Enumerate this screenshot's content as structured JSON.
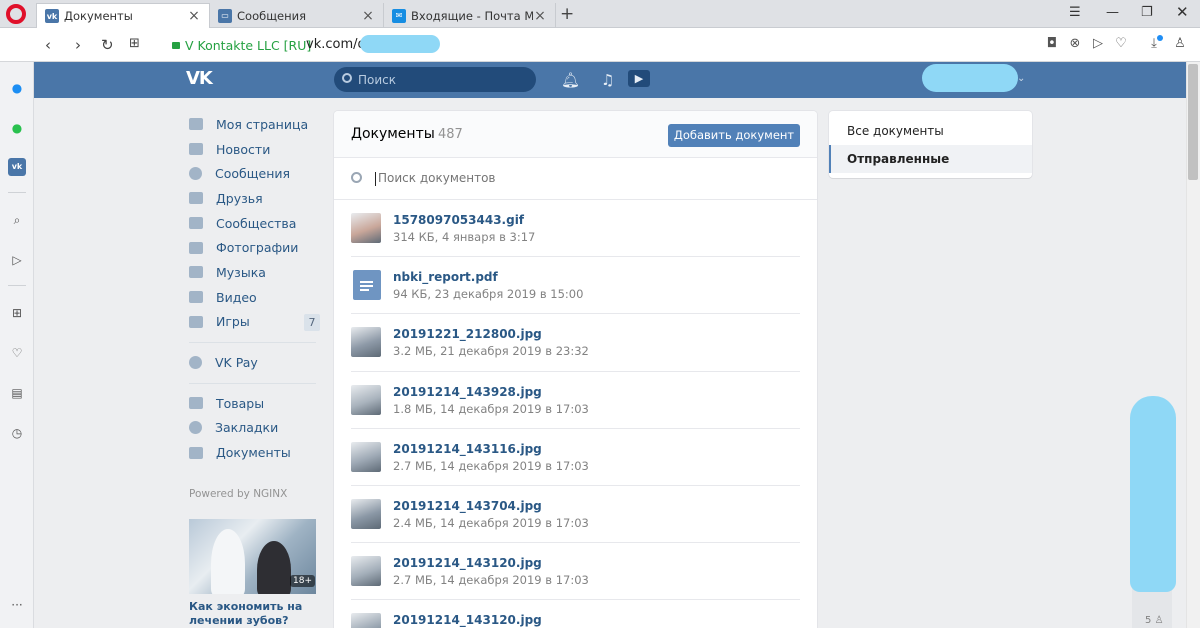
{
  "browser": {
    "tabs": [
      {
        "title": "Документы",
        "favicon": "vk-icon",
        "active": true
      },
      {
        "title": "Сообщения",
        "favicon": "vk-chat-icon",
        "active": false
      },
      {
        "title": "Входящие - Почта Mail.ru",
        "favicon": "mail-icon",
        "active": false
      }
    ],
    "secure_label": "V Kontakte LLC [RU]",
    "url": "vk.com/doc",
    "accent": "#e0102a"
  },
  "vk": {
    "search_placeholder": "Поиск",
    "brand_color": "#4a76a8"
  },
  "left_menu": {
    "items": [
      {
        "label": "Моя страница",
        "icon": "home-icon"
      },
      {
        "label": "Новости",
        "icon": "news-icon"
      },
      {
        "label": "Сообщения",
        "icon": "messages-icon"
      },
      {
        "label": "Друзья",
        "icon": "friends-icon"
      },
      {
        "label": "Сообщества",
        "icon": "groups-icon"
      },
      {
        "label": "Фотографии",
        "icon": "photo-icon"
      },
      {
        "label": "Музыка",
        "icon": "music-icon"
      },
      {
        "label": "Видео",
        "icon": "video-icon"
      },
      {
        "label": "Игры",
        "icon": "games-icon",
        "badge": "7"
      }
    ],
    "vkpay": "VK Pay",
    "extra": [
      {
        "label": "Товары",
        "icon": "bag-icon"
      },
      {
        "label": "Закладки",
        "icon": "star-icon"
      },
      {
        "label": "Документы",
        "icon": "document-icon"
      }
    ],
    "powered": "Powered by NGINX",
    "ad": {
      "badge": "18+",
      "title": "Как экономить на лечении зубов?"
    }
  },
  "docs": {
    "title": "Документы",
    "count": "487",
    "add_button": "Добавить документ",
    "search_placeholder": "Поиск документов",
    "items": [
      {
        "name": "1578097053443.gif",
        "meta": "314 КБ, 4 января в 3:17",
        "thumb": "photo"
      },
      {
        "name": "nbki_report.pdf",
        "meta": "94 КБ, 23 декабря 2019 в 15:00",
        "thumb": "file"
      },
      {
        "name": "20191221_212800.jpg",
        "meta": "3.2 МБ, 21 декабря 2019 в 23:32",
        "thumb": "photo"
      },
      {
        "name": "20191214_143928.jpg",
        "meta": "1.8 МБ, 14 декабря 2019 в 17:03",
        "thumb": "photo"
      },
      {
        "name": "20191214_143116.jpg",
        "meta": "2.7 МБ, 14 декабря 2019 в 17:03",
        "thumb": "photo"
      },
      {
        "name": "20191214_143704.jpg",
        "meta": "2.4 МБ, 14 декабря 2019 в 17:03",
        "thumb": "photo"
      },
      {
        "name": "20191214_143120.jpg",
        "meta": "2.7 МБ, 14 декабря 2019 в 17:03",
        "thumb": "photo"
      },
      {
        "name": "20191214_143120.jpg",
        "meta": "",
        "thumb": "photo"
      }
    ]
  },
  "filters": {
    "items": [
      {
        "label": "Все документы",
        "active": false
      },
      {
        "label": "Отправленные",
        "active": true
      }
    ]
  },
  "mini_chat": {
    "count": "5"
  }
}
